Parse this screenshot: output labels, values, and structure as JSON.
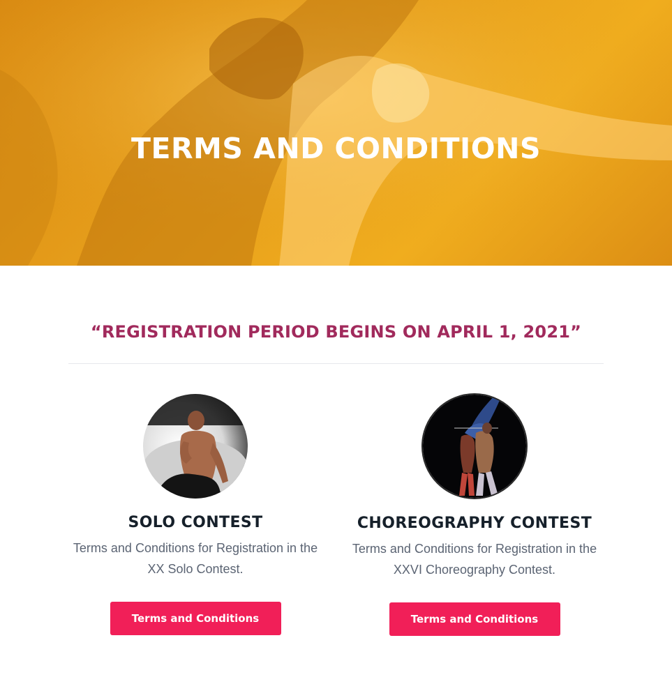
{
  "hero": {
    "title": "TERMS AND CONDITIONS"
  },
  "notice": {
    "text": "“REGISTRATION PERIOD BEGINS ON APRIL 1, 2021”"
  },
  "cards": [
    {
      "title": "SOLO CONTEST",
      "description": "Terms and Conditions for Registration in the XX Solo Contest.",
      "button_label": "Terms and Conditions"
    },
    {
      "title": "CHOREOGRAPHY CONTEST",
      "description": "Terms and Conditions for Registration in the XXVI Choreography Contest.",
      "button_label": "Terms and Conditions"
    }
  ],
  "colors": {
    "hero_overlay": "#e39a18",
    "notice_text": "#a12a5c",
    "button_bg": "#f11f58",
    "title_text": "#16202a",
    "body_text": "#5b6473"
  }
}
